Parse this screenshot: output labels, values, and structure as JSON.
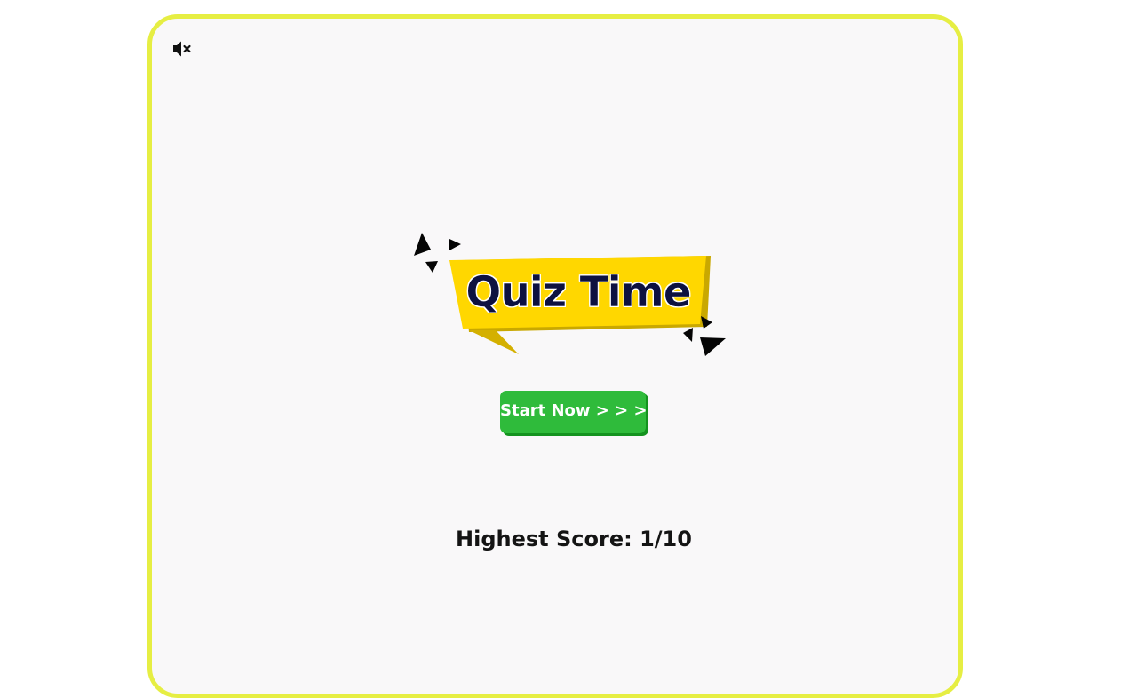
{
  "game": {
    "title": "Quiz Time",
    "start_label": "Start Now > > >",
    "high_score_label": "Highest Score:",
    "high_score_value": "1/10"
  },
  "icons": {
    "mute": "speaker-muted-icon",
    "sparkle": "sparkle-triangles-icon"
  },
  "colors": {
    "frame_border": "#e6ee43",
    "frame_bg": "#f9f8f9",
    "banner_yellow": "#ffd700",
    "banner_shadow": "#c9a800",
    "title_text": "#0d1140",
    "start_button": "#2fbb3b",
    "start_button_shadow": "#14931f"
  }
}
